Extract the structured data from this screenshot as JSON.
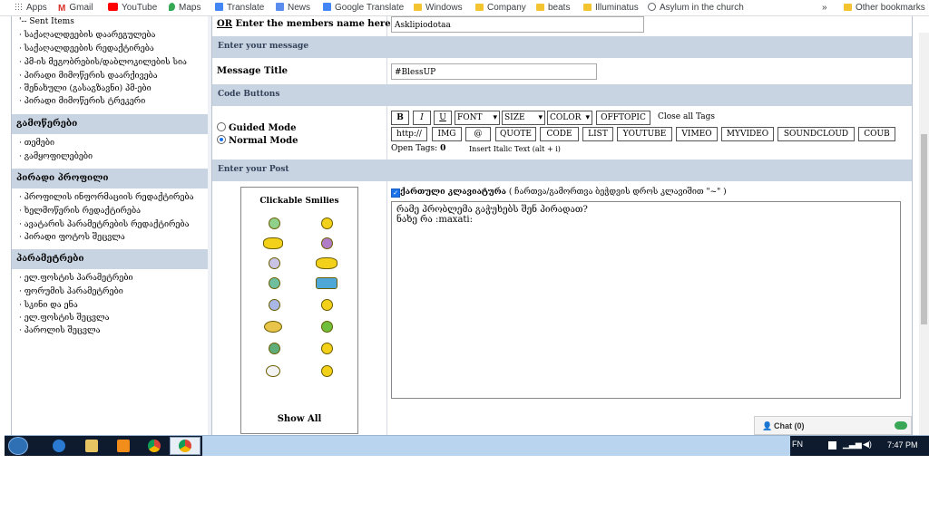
{
  "bookmarks": {
    "apps": "Apps",
    "gmail": "Gmail",
    "youtube": "YouTube",
    "maps": "Maps",
    "translate": "Translate",
    "news": "News",
    "google_translate": "Google Translate",
    "windows": "Windows",
    "company": "Company",
    "beats": "beats",
    "illuminatus": "Illuminatus",
    "asylum": "Asylum in the church",
    "more": "»",
    "other": "Other bookmarks"
  },
  "sidebar": {
    "top_items": [
      "'-- Sent Items",
      "· საქაღალდეების დაარეგულება",
      "· საქაღალდეების რედაქტირება",
      "· პმ-ის მეგობრების/დაბლოკილების სია",
      "· პირადი მიმოწერის დაარქივება",
      "· შენახული (გასაგზავნი) პმ-ები",
      "· პირადი მიმოწერის ტრეკერი"
    ],
    "section_tracking": "გამოწერები",
    "tracking_items": [
      "· თემები",
      "· გამყოფილებები"
    ],
    "section_profile": "პირადი პროფილი",
    "profile_items": [
      "· პროფილის ინფორმაციის რედაქტირება",
      "· ხელმოწერის რედაქტირება",
      "· ავატარის პარამეტრების რედაქტირება",
      "· პირადი ფოტოს შეცვლა"
    ],
    "section_settings": "პარამეტრები",
    "settings_items": [
      "· ელ.ფოსტის პარამეტრები",
      "· ფორუმის პარამეტრები",
      "· სკინი და ენა",
      "· ელ.ფოსტის შეცვლა",
      "· პაროლის შეცვლა"
    ]
  },
  "form": {
    "members_label_prefix": "OR",
    "members_label": " Enter the members name here",
    "members_value": "Asklipiodotaa",
    "section_message": "Enter your message",
    "title_label": "Message Title",
    "title_value": "#BlessUP",
    "section_codes": "Code Buttons",
    "guided_mode": "Guided Mode",
    "normal_mode": "Normal Mode",
    "section_post": "Enter your Post",
    "open_tags_label": "Open Tags:",
    "open_tags_value": "0",
    "insert_italic": "Insert Italic Text (alt + i)",
    "close_all_tags": "Close all Tags",
    "keyboard_label": "ქართული კლავიატურა",
    "keyboard_hint": " ( ჩართვა/გამორთვა ბეჭდვის დროს კლავიშით \"~\" )",
    "post_line1": "რამე პრობლემა გაჭუხებს შენ პირადათ?",
    "post_line2": "ნახე რა  :maxati:"
  },
  "code_buttons": {
    "bold": "B",
    "italic": "I",
    "underline": "U",
    "font": "FONT",
    "size": "SIZE",
    "color": "COLOR",
    "offtopic": "OFFTOPIC",
    "http": "http://",
    "img": "IMG",
    "at": "@",
    "quote": "QUOTE",
    "code": "CODE",
    "list": "LIST",
    "youtube": "YOUTUBE",
    "vimeo": "VIMEO",
    "myvideo": "MYVIDEO",
    "soundcloud": "SOUNDCLOUD",
    "coub": "COUB"
  },
  "smilies": {
    "title": "Clickable Smilies",
    "show_all": "Show All"
  },
  "chat": {
    "label": "Chat (0)"
  },
  "taskbar": {
    "lang": "FN",
    "time": "7:47 PM"
  }
}
